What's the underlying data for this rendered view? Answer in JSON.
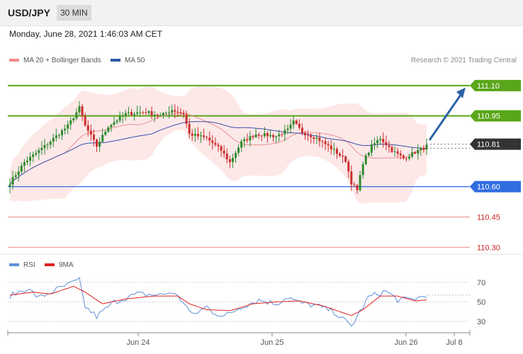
{
  "header": {
    "symbol": "USD/JPY",
    "interval": "30 MIN"
  },
  "datetime": "Monday, June 28, 2021 1:46:03 AM CET",
  "legend": {
    "ma20_label": "MA 20 + Bollinger Bands",
    "ma50_label": "MA 50",
    "rsi_label": "RSI",
    "ma9_label": "9MA"
  },
  "copyright": "Research © 2021 Trading Central",
  "colors": {
    "resistance": "#5aa619",
    "support": "#2f6de0",
    "target": "#e04040",
    "current": "#333333",
    "bullish": "#2e8b2e",
    "bearish": "#cc2d2d",
    "ma20": "#e89090",
    "ma50": "#3b4fa8",
    "bollinger": "#fde4e4",
    "arrow": "#2b63a8"
  },
  "chart_data": [
    {
      "type": "candlestick",
      "title": "USD/JPY",
      "interval": "30 MIN",
      "ylim": [
        110.28,
        111.18
      ],
      "x_ticks": [
        "Jun 24",
        "Jun 25",
        "Jun 26",
        "Jul 8"
      ],
      "levels": [
        {
          "value": 111.1,
          "label": "111.10",
          "kind": "resistance"
        },
        {
          "value": 110.95,
          "label": "110.95",
          "kind": "resistance"
        },
        {
          "value": 110.81,
          "label": "110.81",
          "kind": "current"
        },
        {
          "value": 110.6,
          "label": "110.60",
          "kind": "support"
        },
        {
          "value": 110.45,
          "label": "110.45",
          "kind": "target"
        },
        {
          "value": 110.3,
          "label": "110.30",
          "kind": "target"
        }
      ],
      "forecast_arrow": {
        "from": 110.81,
        "to": 111.1
      },
      "anchors": [
        [
          0,
          110.62
        ],
        [
          5,
          110.72
        ],
        [
          12,
          110.8
        ],
        [
          20,
          110.9
        ],
        [
          24,
          110.99
        ],
        [
          26,
          110.9
        ],
        [
          30,
          110.8
        ],
        [
          34,
          110.9
        ],
        [
          40,
          110.96
        ],
        [
          47,
          110.97
        ],
        [
          52,
          110.95
        ],
        [
          56,
          110.98
        ],
        [
          60,
          110.96
        ],
        [
          62,
          110.86
        ],
        [
          68,
          110.84
        ],
        [
          73,
          110.78
        ],
        [
          76,
          110.72
        ],
        [
          80,
          110.82
        ],
        [
          85,
          110.86
        ],
        [
          92,
          110.85
        ],
        [
          96,
          110.88
        ],
        [
          98,
          110.92
        ],
        [
          101,
          110.87
        ],
        [
          106,
          110.84
        ],
        [
          112,
          110.78
        ],
        [
          116,
          110.73
        ],
        [
          118,
          110.62
        ],
        [
          120,
          110.58
        ],
        [
          122,
          110.72
        ],
        [
          125,
          110.8
        ],
        [
          128,
          110.84
        ],
        [
          132,
          110.78
        ],
        [
          136,
          110.74
        ],
        [
          140,
          110.77
        ],
        [
          144,
          110.8
        ]
      ]
    },
    {
      "type": "line",
      "title": "RSI",
      "ylim": [
        22,
        80
      ],
      "y_ticks": [
        70,
        50,
        30
      ],
      "series": [
        {
          "name": "RSI",
          "anchors": [
            [
              0,
              56
            ],
            [
              6,
              64
            ],
            [
              10,
              54
            ],
            [
              15,
              61
            ],
            [
              22,
              70
            ],
            [
              24,
              72
            ],
            [
              26,
              45
            ],
            [
              30,
              35
            ],
            [
              36,
              50
            ],
            [
              44,
              58
            ],
            [
              52,
              57
            ],
            [
              56,
              60
            ],
            [
              60,
              50
            ],
            [
              63,
              36
            ],
            [
              68,
              45
            ],
            [
              70,
              40
            ],
            [
              74,
              35
            ],
            [
              80,
              45
            ],
            [
              86,
              52
            ],
            [
              92,
              48
            ],
            [
              96,
              55
            ],
            [
              100,
              49
            ],
            [
              106,
              46
            ],
            [
              112,
              40
            ],
            [
              116,
              30
            ],
            [
              118,
              25
            ],
            [
              120,
              35
            ],
            [
              124,
              55
            ],
            [
              130,
              61
            ],
            [
              134,
              52
            ],
            [
              140,
              53
            ],
            [
              144,
              57
            ]
          ]
        },
        {
          "name": "9MA",
          "anchors": [
            [
              0,
              57
            ],
            [
              8,
              60
            ],
            [
              14,
              58
            ],
            [
              22,
              66
            ],
            [
              26,
              60
            ],
            [
              32,
              48
            ],
            [
              40,
              53
            ],
            [
              50,
              56
            ],
            [
              58,
              56
            ],
            [
              62,
              48
            ],
            [
              68,
              42
            ],
            [
              76,
              41
            ],
            [
              84,
              48
            ],
            [
              92,
              50
            ],
            [
              100,
              51
            ],
            [
              108,
              46
            ],
            [
              114,
              40
            ],
            [
              118,
              36
            ],
            [
              122,
              42
            ],
            [
              128,
              56
            ],
            [
              134,
              56
            ],
            [
              140,
              51
            ],
            [
              144,
              52
            ]
          ]
        }
      ]
    }
  ]
}
